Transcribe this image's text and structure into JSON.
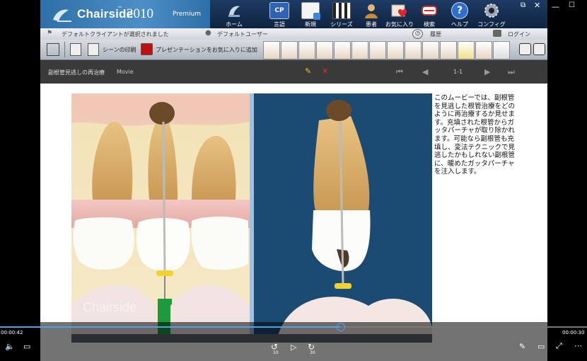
{
  "app": {
    "brand": "Chairside",
    "trademark": "™",
    "year": "2010",
    "edition": "Premium"
  },
  "top_nav": [
    {
      "label": "ホーム",
      "icon": "home-icon"
    },
    {
      "label": "言語",
      "icon": "language-icon"
    },
    {
      "label": "新規",
      "icon": "new-icon"
    },
    {
      "label": "シリーズ",
      "icon": "series-icon"
    },
    {
      "label": "患者",
      "icon": "patient-icon"
    },
    {
      "label": "お気に入り",
      "icon": "favorites-icon"
    },
    {
      "label": "検索",
      "icon": "search-icon"
    },
    {
      "label": "ヘルプ",
      "icon": "help-icon"
    },
    {
      "label": "コンフィグ",
      "icon": "config-icon"
    }
  ],
  "language_badge": "CP",
  "status": {
    "client": "デフォルトクライアントが選択されました",
    "user": "デフォルトユーザー",
    "history": "履歴",
    "login": "ログイン"
  },
  "toolbar": {
    "print_scene": "シーンの印刷",
    "add_favorite": "プレゼンテーションをお気に入りに追加"
  },
  "presentation": {
    "title": "副根管見逃しの再治療",
    "type": "Movie",
    "page": "1-1"
  },
  "description": "このムービーでは、副根管を見逃した根管治療をどのように再治療するか見せます。充填された根管からガッタパーチャが取り除かれます。可能なら副根管も充填し、変法テクニックで見逃したかもしれない副根管に、暖めたガッタパーチャを注入します。",
  "watermark": "Chairside",
  "player": {
    "elapsed": "00:00:42",
    "remaining": "00:00:30",
    "progress": 0.58,
    "skip_back": "10",
    "skip_forward": "30"
  }
}
